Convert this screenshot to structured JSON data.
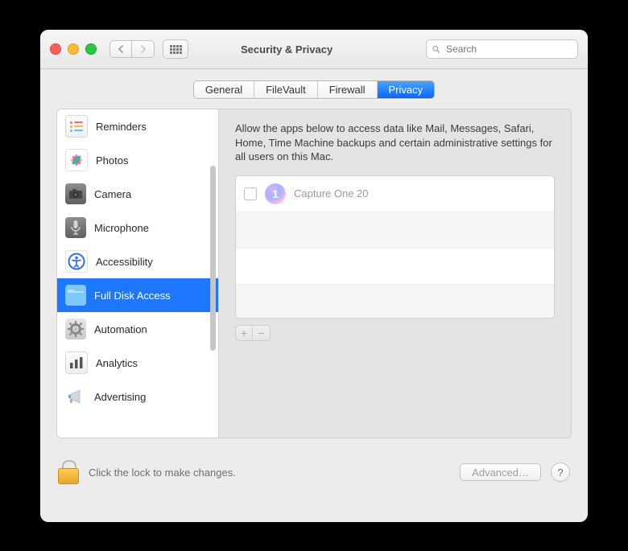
{
  "window": {
    "title": "Security & Privacy",
    "search_placeholder": "Search"
  },
  "tabs": [
    "General",
    "FileVault",
    "Firewall",
    "Privacy"
  ],
  "active_tab": "Privacy",
  "sidebar": [
    {
      "label": "Reminders"
    },
    {
      "label": "Photos"
    },
    {
      "label": "Camera"
    },
    {
      "label": "Microphone"
    },
    {
      "label": "Accessibility"
    },
    {
      "label": "Full Disk Access",
      "selected": true
    },
    {
      "label": "Automation"
    },
    {
      "label": "Analytics"
    },
    {
      "label": "Advertising"
    }
  ],
  "detail": {
    "category": "Full Disk Access",
    "description": "Allow the apps below to access data like Mail, Messages, Safari, Home, Time Machine backups and certain administrative settings for all users on this Mac.",
    "apps": [
      {
        "name": "Capture One 20",
        "checked": false
      }
    ]
  },
  "footer": {
    "lock_hint": "Click the lock to make changes.",
    "advanced_label": "Advanced…"
  }
}
